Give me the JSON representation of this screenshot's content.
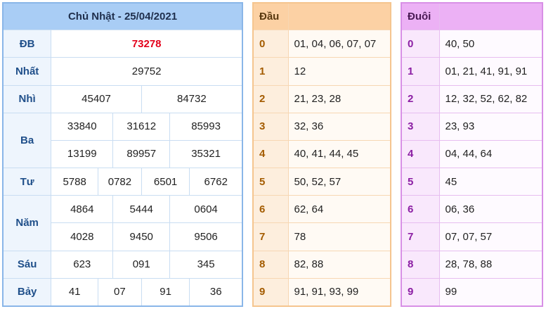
{
  "results": {
    "title": "Chủ Nhật - 25/04/2021",
    "prizes": {
      "db": {
        "label": "ĐB",
        "values": [
          "73278"
        ]
      },
      "nhat": {
        "label": "Nhất",
        "values": [
          "29752"
        ]
      },
      "nhi": {
        "label": "Nhì",
        "values": [
          "45407",
          "84732"
        ]
      },
      "ba": {
        "label": "Ba",
        "values": [
          "33840",
          "31612",
          "85993",
          "13199",
          "89957",
          "35321"
        ]
      },
      "tu": {
        "label": "Tư",
        "values": [
          "5788",
          "0782",
          "6501",
          "6762"
        ]
      },
      "nam": {
        "label": "Năm",
        "values": [
          "4864",
          "5444",
          "0604",
          "4028",
          "9450",
          "9506"
        ]
      },
      "sau": {
        "label": "Sáu",
        "values": [
          "623",
          "091",
          "345"
        ]
      },
      "bay": {
        "label": "Bảy",
        "values": [
          "41",
          "07",
          "91",
          "36"
        ]
      }
    }
  },
  "dau": {
    "header": "Đầu",
    "rows": [
      {
        "digit": "0",
        "values": "01, 04, 06, 07, 07"
      },
      {
        "digit": "1",
        "values": "12"
      },
      {
        "digit": "2",
        "values": "21, 23, 28"
      },
      {
        "digit": "3",
        "values": "32, 36"
      },
      {
        "digit": "4",
        "values": "40, 41, 44, 45"
      },
      {
        "digit": "5",
        "values": "50, 52, 57"
      },
      {
        "digit": "6",
        "values": "62, 64"
      },
      {
        "digit": "7",
        "values": "78"
      },
      {
        "digit": "8",
        "values": "82, 88"
      },
      {
        "digit": "9",
        "values": "91, 91, 93, 99"
      }
    ]
  },
  "duoi": {
    "header": "Đuôi",
    "rows": [
      {
        "digit": "0",
        "values": "40, 50"
      },
      {
        "digit": "1",
        "values": "01, 21, 41, 91, 91"
      },
      {
        "digit": "2",
        "values": "12, 32, 52, 62, 82"
      },
      {
        "digit": "3",
        "values": "23, 93"
      },
      {
        "digit": "4",
        "values": "04, 44, 64"
      },
      {
        "digit": "5",
        "values": "45"
      },
      {
        "digit": "6",
        "values": "06, 36"
      },
      {
        "digit": "7",
        "values": "07, 07, 57"
      },
      {
        "digit": "8",
        "values": "28, 78, 88"
      },
      {
        "digit": "9",
        "values": "99"
      }
    ]
  },
  "colors": {
    "results_header": "#a9cdf5",
    "special_prize": "#e3001b",
    "dau_header": "#fcd1a4",
    "duoi_header": "#ecb1f5"
  }
}
